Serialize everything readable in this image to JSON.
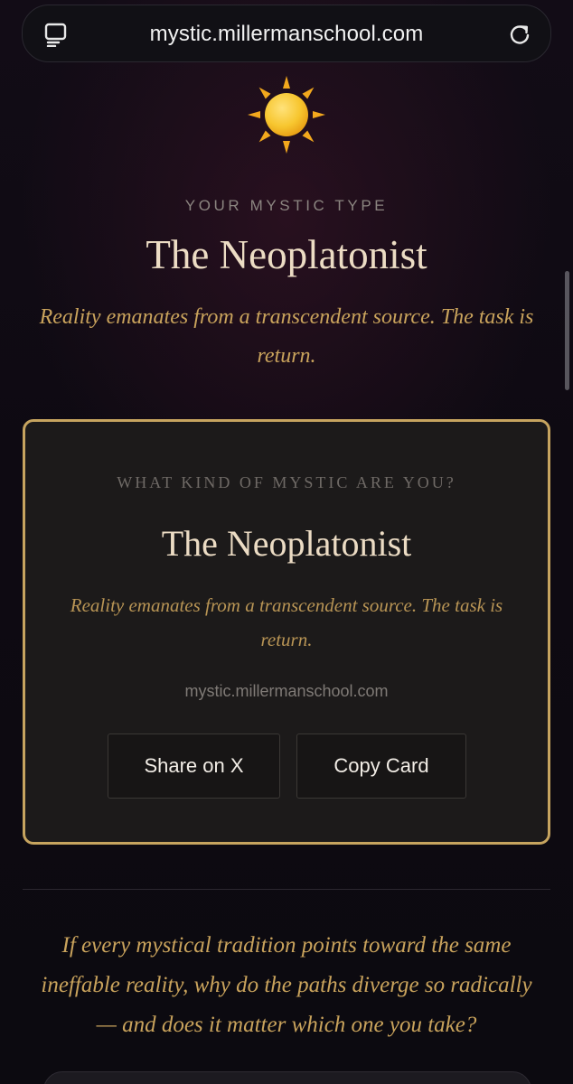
{
  "browser": {
    "url": "mystic.millermanschool.com",
    "tabs_icon": "tabs-icon",
    "reload_icon": "reload-icon"
  },
  "hero": {
    "icon": "sun-icon",
    "kicker": "YOUR MYSTIC TYPE",
    "title": "The Neoplatonist",
    "tagline": "Reality emanates from a transcendent source. The task is return."
  },
  "card": {
    "kicker": "WHAT KIND OF MYSTIC ARE YOU?",
    "title": "The Neoplatonist",
    "tagline": "Reality emanates from a transcendent source. The task is return.",
    "url": "mystic.millermanschool.com",
    "share_label": "Share on X",
    "copy_label": "Copy Card"
  },
  "essay": {
    "question": "If every mystical tradition points toward the same ineffable reality, why do the paths diverge so radically — and does it matter which one you take?"
  },
  "colors": {
    "background": "#0d0a10",
    "gold_accent": "#c6a45f",
    "title_cream": "#ecdcc4",
    "tagline_gold": "#c9a35c",
    "card_bg": "#1c1a1a"
  }
}
